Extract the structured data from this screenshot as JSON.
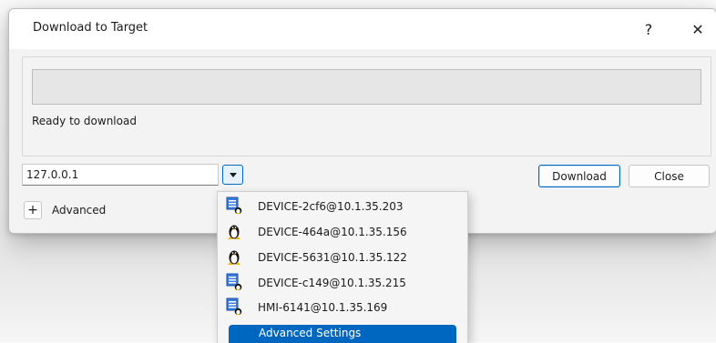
{
  "dialog": {
    "title": "Download to Target",
    "help_label": "?",
    "close_label": "✕"
  },
  "status": {
    "progress_percent": 0,
    "message": "Ready to download"
  },
  "target": {
    "value": "127.0.0.1"
  },
  "buttons": {
    "download_label": "Download",
    "close_label": "Close",
    "expand_label": "+",
    "advanced_label": "Advanced"
  },
  "dropdown": {
    "items": [
      {
        "label": "DEVICE-2cf6@10.1.35.203",
        "icon": "device-icon"
      },
      {
        "label": "DEVICE-464a@10.1.35.156",
        "icon": "linux-icon"
      },
      {
        "label": "DEVICE-5631@10.1.35.122",
        "icon": "linux-icon"
      },
      {
        "label": "DEVICE-c149@10.1.35.215",
        "icon": "device-icon"
      },
      {
        "label": "HMI-6141@10.1.35.169",
        "icon": "device-icon"
      }
    ],
    "advanced_settings_label": "Advanced Settings"
  },
  "colors": {
    "accent": "#0067c0",
    "progress_fill": "#06b025"
  }
}
